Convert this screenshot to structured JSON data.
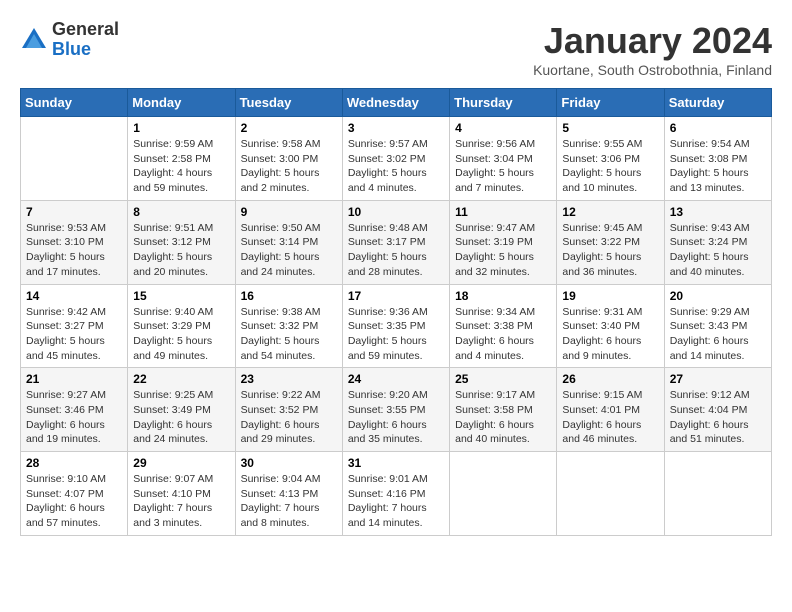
{
  "logo": {
    "general": "General",
    "blue": "Blue"
  },
  "title": "January 2024",
  "subtitle": "Kuortane, South Ostrobothnia, Finland",
  "headers": [
    "Sunday",
    "Monday",
    "Tuesday",
    "Wednesday",
    "Thursday",
    "Friday",
    "Saturday"
  ],
  "weeks": [
    [
      {
        "day": "",
        "info": ""
      },
      {
        "day": "1",
        "info": "Sunrise: 9:59 AM\nSunset: 2:58 PM\nDaylight: 4 hours\nand 59 minutes."
      },
      {
        "day": "2",
        "info": "Sunrise: 9:58 AM\nSunset: 3:00 PM\nDaylight: 5 hours\nand 2 minutes."
      },
      {
        "day": "3",
        "info": "Sunrise: 9:57 AM\nSunset: 3:02 PM\nDaylight: 5 hours\nand 4 minutes."
      },
      {
        "day": "4",
        "info": "Sunrise: 9:56 AM\nSunset: 3:04 PM\nDaylight: 5 hours\nand 7 minutes."
      },
      {
        "day": "5",
        "info": "Sunrise: 9:55 AM\nSunset: 3:06 PM\nDaylight: 5 hours\nand 10 minutes."
      },
      {
        "day": "6",
        "info": "Sunrise: 9:54 AM\nSunset: 3:08 PM\nDaylight: 5 hours\nand 13 minutes."
      }
    ],
    [
      {
        "day": "7",
        "info": "Sunrise: 9:53 AM\nSunset: 3:10 PM\nDaylight: 5 hours\nand 17 minutes."
      },
      {
        "day": "8",
        "info": "Sunrise: 9:51 AM\nSunset: 3:12 PM\nDaylight: 5 hours\nand 20 minutes."
      },
      {
        "day": "9",
        "info": "Sunrise: 9:50 AM\nSunset: 3:14 PM\nDaylight: 5 hours\nand 24 minutes."
      },
      {
        "day": "10",
        "info": "Sunrise: 9:48 AM\nSunset: 3:17 PM\nDaylight: 5 hours\nand 28 minutes."
      },
      {
        "day": "11",
        "info": "Sunrise: 9:47 AM\nSunset: 3:19 PM\nDaylight: 5 hours\nand 32 minutes."
      },
      {
        "day": "12",
        "info": "Sunrise: 9:45 AM\nSunset: 3:22 PM\nDaylight: 5 hours\nand 36 minutes."
      },
      {
        "day": "13",
        "info": "Sunrise: 9:43 AM\nSunset: 3:24 PM\nDaylight: 5 hours\nand 40 minutes."
      }
    ],
    [
      {
        "day": "14",
        "info": "Sunrise: 9:42 AM\nSunset: 3:27 PM\nDaylight: 5 hours\nand 45 minutes."
      },
      {
        "day": "15",
        "info": "Sunrise: 9:40 AM\nSunset: 3:29 PM\nDaylight: 5 hours\nand 49 minutes."
      },
      {
        "day": "16",
        "info": "Sunrise: 9:38 AM\nSunset: 3:32 PM\nDaylight: 5 hours\nand 54 minutes."
      },
      {
        "day": "17",
        "info": "Sunrise: 9:36 AM\nSunset: 3:35 PM\nDaylight: 5 hours\nand 59 minutes."
      },
      {
        "day": "18",
        "info": "Sunrise: 9:34 AM\nSunset: 3:38 PM\nDaylight: 6 hours\nand 4 minutes."
      },
      {
        "day": "19",
        "info": "Sunrise: 9:31 AM\nSunset: 3:40 PM\nDaylight: 6 hours\nand 9 minutes."
      },
      {
        "day": "20",
        "info": "Sunrise: 9:29 AM\nSunset: 3:43 PM\nDaylight: 6 hours\nand 14 minutes."
      }
    ],
    [
      {
        "day": "21",
        "info": "Sunrise: 9:27 AM\nSunset: 3:46 PM\nDaylight: 6 hours\nand 19 minutes."
      },
      {
        "day": "22",
        "info": "Sunrise: 9:25 AM\nSunset: 3:49 PM\nDaylight: 6 hours\nand 24 minutes."
      },
      {
        "day": "23",
        "info": "Sunrise: 9:22 AM\nSunset: 3:52 PM\nDaylight: 6 hours\nand 29 minutes."
      },
      {
        "day": "24",
        "info": "Sunrise: 9:20 AM\nSunset: 3:55 PM\nDaylight: 6 hours\nand 35 minutes."
      },
      {
        "day": "25",
        "info": "Sunrise: 9:17 AM\nSunset: 3:58 PM\nDaylight: 6 hours\nand 40 minutes."
      },
      {
        "day": "26",
        "info": "Sunrise: 9:15 AM\nSunset: 4:01 PM\nDaylight: 6 hours\nand 46 minutes."
      },
      {
        "day": "27",
        "info": "Sunrise: 9:12 AM\nSunset: 4:04 PM\nDaylight: 6 hours\nand 51 minutes."
      }
    ],
    [
      {
        "day": "28",
        "info": "Sunrise: 9:10 AM\nSunset: 4:07 PM\nDaylight: 6 hours\nand 57 minutes."
      },
      {
        "day": "29",
        "info": "Sunrise: 9:07 AM\nSunset: 4:10 PM\nDaylight: 7 hours\nand 3 minutes."
      },
      {
        "day": "30",
        "info": "Sunrise: 9:04 AM\nSunset: 4:13 PM\nDaylight: 7 hours\nand 8 minutes."
      },
      {
        "day": "31",
        "info": "Sunrise: 9:01 AM\nSunset: 4:16 PM\nDaylight: 7 hours\nand 14 minutes."
      },
      {
        "day": "",
        "info": ""
      },
      {
        "day": "",
        "info": ""
      },
      {
        "day": "",
        "info": ""
      }
    ]
  ]
}
